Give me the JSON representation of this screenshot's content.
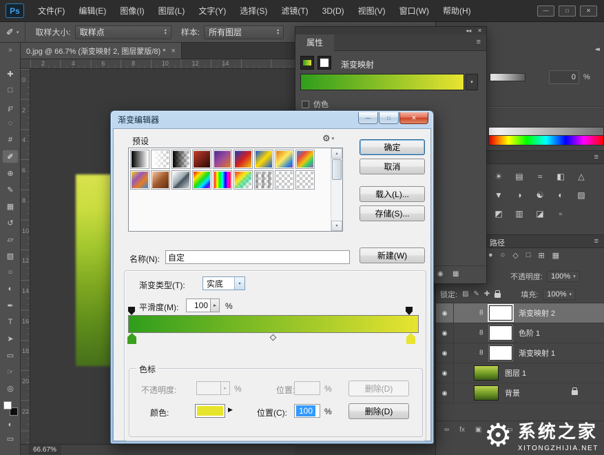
{
  "glyphs": {
    "chevron_down": "▾",
    "chevron_up": "▴",
    "chevron_right": "▸",
    "expand": "»",
    "collapse": "◂◂",
    "menu": "≡",
    "close": "✕",
    "flyout": "▶",
    "gear": "⚙",
    "eye": "◉"
  },
  "checker_css": "linear-gradient(45deg,#c9c9c9 25%,rgba(0,0,0,0) 25%,rgba(0,0,0,0) 75%,#c9c9c9 75%),linear-gradient(45deg,#c9c9c9 25%,rgba(0,0,0,0) 25%,rgba(0,0,0,0) 75%,#c9c9c9 75%)",
  "app": {
    "logo": "Ps",
    "window_controls": {
      "minimize": "—",
      "maximize": "□",
      "close": "✕"
    }
  },
  "menu": {
    "items": [
      "文件(F)",
      "编辑(E)",
      "图像(I)",
      "图层(L)",
      "文字(Y)",
      "选择(S)",
      "滤镜(T)",
      "3D(D)",
      "视图(V)",
      "窗口(W)",
      "帮助(H)"
    ]
  },
  "options_bar": {
    "tool_glyph": "✐",
    "sample_size_label": "取样大小:",
    "sample_size_value": "取样点",
    "sample_label": "样本:",
    "sample_value": "所有图层"
  },
  "toolbar": {
    "selected_index": 5,
    "tools": [
      {
        "name": "move-tool",
        "glyph": "✚"
      },
      {
        "name": "marquee-tool",
        "glyph": "□"
      },
      {
        "name": "lasso-tool",
        "glyph": "℘"
      },
      {
        "name": "quick-selection-tool",
        "glyph": "◌"
      },
      {
        "name": "crop-tool",
        "glyph": "#"
      },
      {
        "name": "eyedropper-tool",
        "glyph": "✐"
      },
      {
        "name": "healing-brush-tool",
        "glyph": "⊕"
      },
      {
        "name": "brush-tool",
        "glyph": "✎"
      },
      {
        "name": "clone-stamp-tool",
        "glyph": "▦"
      },
      {
        "name": "history-brush-tool",
        "glyph": "↺"
      },
      {
        "name": "eraser-tool",
        "glyph": "▱"
      },
      {
        "name": "gradient-tool",
        "glyph": "▧"
      },
      {
        "name": "blur-tool",
        "glyph": "○"
      },
      {
        "name": "dodge-tool",
        "glyph": "◐"
      },
      {
        "name": "pen-tool",
        "glyph": "✒"
      },
      {
        "name": "type-tool",
        "glyph": "T"
      },
      {
        "name": "path-selection-tool",
        "glyph": "➤"
      },
      {
        "name": "shape-tool",
        "glyph": "▭"
      },
      {
        "name": "hand-tool",
        "glyph": "☞"
      },
      {
        "name": "zoom-tool",
        "glyph": "◎"
      }
    ],
    "quick_mask_glyph": "◐",
    "screen_mode_glyph": "▭"
  },
  "document": {
    "tab_title": "0.jpg @ 66.7% (渐变映射 2, 图层蒙版/8) *",
    "tab_close": "×",
    "ruler_h": [
      "2",
      "4",
      "6",
      "8",
      "10",
      "12",
      "14"
    ],
    "ruler_v": [
      "0",
      "2",
      "4",
      "6",
      "8",
      "10",
      "12",
      "14",
      "16",
      "18",
      "20",
      "22"
    ],
    "status_zoom": "66.67%"
  },
  "canvas": {
    "photo_css": "linear-gradient(180deg,#d8e24e 0%,#cadd3f 18%,#a3c72e 38%,#7fa821 58%,#5f8d1b 78%,#47701b 100%)"
  },
  "properties_panel": {
    "tab": "属性",
    "adjustment_label": "渐变映射",
    "dither_label": "仿色",
    "gradient_css": "linear-gradient(90deg,#2f9d1c,#e8e431)",
    "footer_icons": [
      "◉",
      "▦"
    ]
  },
  "dock": {
    "density_value": "0",
    "percent": "%",
    "density_css": "linear-gradient(90deg,#ffffff,#5a5a5a)",
    "gray_ramp_css": "linear-gradient(90deg,#ffffff,#6f6f6f)",
    "spectrum_css": "linear-gradient(90deg,#ff0000,#ffff00 17%,#00ff00 33%,#00ffff 50%,#0000ff 67%,#ff00ff 83%,#ff0000)",
    "adjustment_icons": [
      "☀",
      "▤",
      "≈",
      "◧",
      "△",
      "▼",
      "◑",
      "☯",
      "◐",
      "▨",
      "◩",
      "▥",
      "◪",
      "▫"
    ],
    "paths_tab": "路径",
    "path_icons": [
      "●",
      "○",
      "◇",
      "□",
      "⊞",
      "▦"
    ]
  },
  "layers_panel": {
    "opacity_label": "不透明度:",
    "opacity_value": "100%",
    "lock_label": "锁定:",
    "lock_icons": [
      "▨",
      "✎",
      "✚"
    ],
    "fill_label": "填充:",
    "fill_value": "100%",
    "chain_glyph": "8",
    "eye_glyph": "◉",
    "thumb_css": "linear-gradient(180deg,#bcd24f,#6f9a24 55%,#3c5c16)",
    "rows": [
      {
        "name": "渐变映射 2",
        "kind": "mask",
        "selected": true,
        "locked": false
      },
      {
        "name": "色阶 1",
        "kind": "mask",
        "selected": false,
        "locked": false
      },
      {
        "name": "渐变映射 1",
        "kind": "mask",
        "selected": false,
        "locked": false
      },
      {
        "name": "图层 1",
        "kind": "image",
        "selected": false,
        "locked": false
      },
      {
        "name": "背景",
        "kind": "image",
        "selected": false,
        "locked": true
      }
    ],
    "footer_icons": [
      "∞",
      "fx",
      "▣",
      "◐",
      "▭",
      "⊞",
      "▦"
    ]
  },
  "gradient_editor": {
    "title": "渐变编辑器",
    "controls": {
      "minimize": "—",
      "maximize": "□",
      "close": "✕"
    },
    "presets_label": "预设",
    "buttons": {
      "ok": "确定",
      "cancel": "取消",
      "load": "载入(L)...",
      "save": "存储(S)..."
    },
    "name_label": "名称(N):",
    "name_value": "自定",
    "new_label": "新建(W)",
    "type_label": "渐变类型(T):",
    "type_value": "实底",
    "smooth_label": "平滑度(M):",
    "smooth_value": "100",
    "percent": "%",
    "stops_label": "色标",
    "opacity_row_label": "不透明度:",
    "location_label": "位置:",
    "delete_label": "删除(D)",
    "color_label": "颜色:",
    "location_c_label": "位置(C):",
    "location_c_value": "100",
    "gradient_css": "linear-gradient(90deg,#2f9d1c,#e8e431)",
    "stop_left_color": "#3aa11f",
    "stop_right_color": "#e8e431",
    "swatch_color": "#e7e42c",
    "presets": [
      {
        "name": "黑白",
        "checker": false,
        "css": "linear-gradient(90deg,#000000,#ffffff)"
      },
      {
        "name": "白到透明",
        "checker": true,
        "css": "linear-gradient(90deg,#ffffff,rgba(255,255,255,0))"
      },
      {
        "name": "黑到透明",
        "checker": true,
        "css": "linear-gradient(90deg,#000000,rgba(0,0,0,0))"
      },
      {
        "name": "红黑",
        "checker": false,
        "css": "linear-gradient(135deg,#c23b2a,#2a0806)"
      },
      {
        "name": "紫橙",
        "checker": false,
        "css": "linear-gradient(135deg,#4a2a8c,#99499c 45%,#e07b28)"
      },
      {
        "name": "蓝红黄",
        "checker": false,
        "css": "linear-gradient(135deg,#1c3bbd,#d32020 50%,#f2c512)"
      },
      {
        "name": "蓝黄蓝",
        "checker": false,
        "css": "linear-gradient(135deg,#1457d6,#ffd900 50%,#1457d6)"
      },
      {
        "name": "橙黄蓝紫",
        "checker": false,
        "css": "linear-gradient(135deg,#e07718,#ffe95a 45%,#2e86d5 80%,#7d3fb2)"
      },
      {
        "name": "彩虹",
        "checker": false,
        "css": "linear-gradient(135deg,#2e86de,#e74c3c 30%,#f1c40f 55%,#2ecc71 75%,#9b59b6)"
      },
      {
        "name": "黄紫橙蓝",
        "checker": false,
        "css": "linear-gradient(135deg,#f5cf20,#9b59b6 35%,#e67e22 65%,#2e86de)"
      },
      {
        "name": "铜色",
        "checker": false,
        "css": "linear-gradient(135deg,#f7c6a3,#a05a2c 50%,#5e2f14)"
      },
      {
        "name": "银色",
        "checker": false,
        "css": "linear-gradient(135deg,#ffffff,#9aa7b0 45%,#45525c 55%,#cfd8dd)"
      },
      {
        "name": "亮彩虹",
        "checker": false,
        "css": "linear-gradient(135deg,#ff0000,#ffe400 25%,#16e016 50%,#00e5ff 68%,#2222ff 84%,#ff00ff)"
      },
      {
        "name": "色谱",
        "checker": false,
        "css": "linear-gradient(90deg,#ff0000,#ffff00 17%,#00ff00 33%,#00ffff 50%,#0000ff 67%,#ff00ff 83%,#ff0000)"
      },
      {
        "name": "透明彩虹",
        "checker": true,
        "css": "linear-gradient(135deg,rgba(255,40,40,0.95),rgba(255,230,0,0.9) 35%,rgba(0,220,120,0.6) 60%,rgba(255,255,255,0) 85%)"
      },
      {
        "name": "透明条纹",
        "checker": true,
        "css": "repeating-linear-gradient(90deg,rgba(90,90,90,0.45) 0 4px,rgba(255,255,255,0) 4px 9px)"
      },
      {
        "name": "透明",
        "checker": true,
        "css": "linear-gradient(0deg,rgba(0,0,0,0),rgba(0,0,0,0))"
      },
      {
        "name": "透明",
        "checker": true,
        "css": "linear-gradient(0deg,rgba(0,0,0,0),rgba(0,0,0,0))"
      }
    ]
  },
  "watermark": {
    "title": "系统之家",
    "subtitle": "XITONGZHIJIA.NET"
  }
}
